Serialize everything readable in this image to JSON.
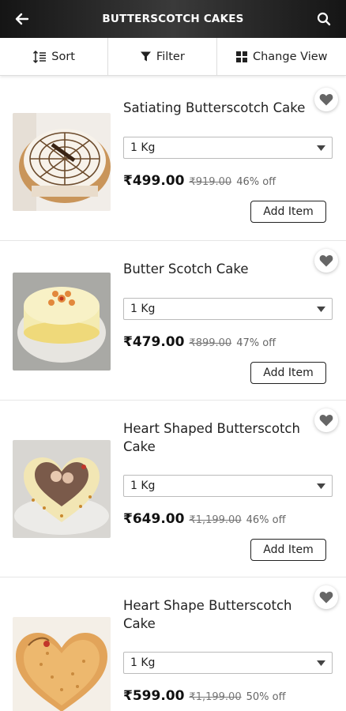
{
  "app_bar": {
    "title": "BUTTERSCOTCH CAKES"
  },
  "toolbar": {
    "sort_label": "Sort",
    "filter_label": "Filter",
    "view_label": "Change View"
  },
  "colors": {
    "app_bar_bg": "#222222",
    "text": "#222222",
    "mrp": "#777777"
  },
  "products": [
    {
      "name": "Satiating Butterscotch Cake",
      "weight": "1 Kg",
      "price": "₹499.00",
      "mrp": "₹919.00",
      "discount": "46% off",
      "add_label": "Add Item",
      "image": "round-cake-chocolate-web"
    },
    {
      "name": "Butter Scotch Cake",
      "weight": "1 Kg",
      "price": "₹479.00",
      "mrp": "₹899.00",
      "discount": "47% off",
      "add_label": "Add Item",
      "image": "round-cream-cake"
    },
    {
      "name": "Heart Shaped Butterscotch Cake",
      "weight": "1 Kg",
      "price": "₹649.00",
      "mrp": "₹1,199.00",
      "discount": "46% off",
      "add_label": "Add Item",
      "image": "heart-photo-cake"
    },
    {
      "name": "Heart Shape Butterscotch Cake",
      "weight": "1 Kg",
      "price": "₹599.00",
      "mrp": "₹1,199.00",
      "discount": "50% off",
      "add_label": "Add Item",
      "image": "heart-nut-cake"
    }
  ]
}
